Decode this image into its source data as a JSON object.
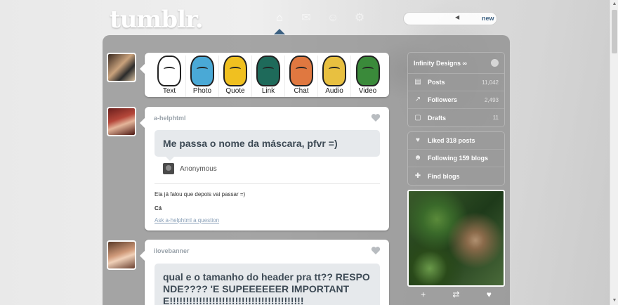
{
  "header": {
    "logo": "tumblr.",
    "nav_icons": [
      "home-icon",
      "envelope-icon",
      "user-icon",
      "gear-icon"
    ],
    "search": {
      "placeholder": "",
      "value": ""
    },
    "search_new_label": "new"
  },
  "post_types": [
    {
      "label": "Text",
      "color": "#ffffff"
    },
    {
      "label": "Photo",
      "color": "#4aa9d6"
    },
    {
      "label": "Quote",
      "color": "#f0c020"
    },
    {
      "label": "Link",
      "color": "#1e6a5a"
    },
    {
      "label": "Chat",
      "color": "#e07840"
    },
    {
      "label": "Audio",
      "color": "#e8c040"
    },
    {
      "label": "Video",
      "color": "#3a8a3a"
    }
  ],
  "posts": [
    {
      "author": "a-helphtml",
      "question": "Me passa o nome da máscara, pfvr =)",
      "asker": "Anonymous",
      "answer": "Ela já falou que depois vai passar =)",
      "signature": "Cá",
      "ask_link": "Ask a-helphtml a question"
    },
    {
      "author": "ilovebanner",
      "question": "qual e o tamanho do header pra tt?? RESPONDE???? 'E SUPEEEEEER IMPORTANTE!!!!!!!!!!!!!!!!!!!!!!!!!!!!!!!!!!!!!!!!!"
    }
  ],
  "sidebar": {
    "blog_name": "Infinity Designs ∞",
    "blog_stats": [
      {
        "label": "Posts",
        "count": "11,042",
        "icon": "posts-icon"
      },
      {
        "label": "Followers",
        "count": "2,493",
        "icon": "followers-icon"
      },
      {
        "label": "Drafts",
        "count": "11",
        "icon": "drafts-icon"
      }
    ],
    "activity": [
      {
        "label": "Liked 318 posts",
        "icon": "heart-icon"
      },
      {
        "label": "Following 159 blogs",
        "icon": "following-icon"
      },
      {
        "label": "Find blogs",
        "icon": "find-blogs-icon"
      }
    ],
    "thumb_actions": [
      "+",
      "⇄",
      "♥"
    ]
  },
  "colors": {
    "panel": "#888888",
    "accent": "#3a5f80",
    "ask_box": "#e6e9ec"
  }
}
